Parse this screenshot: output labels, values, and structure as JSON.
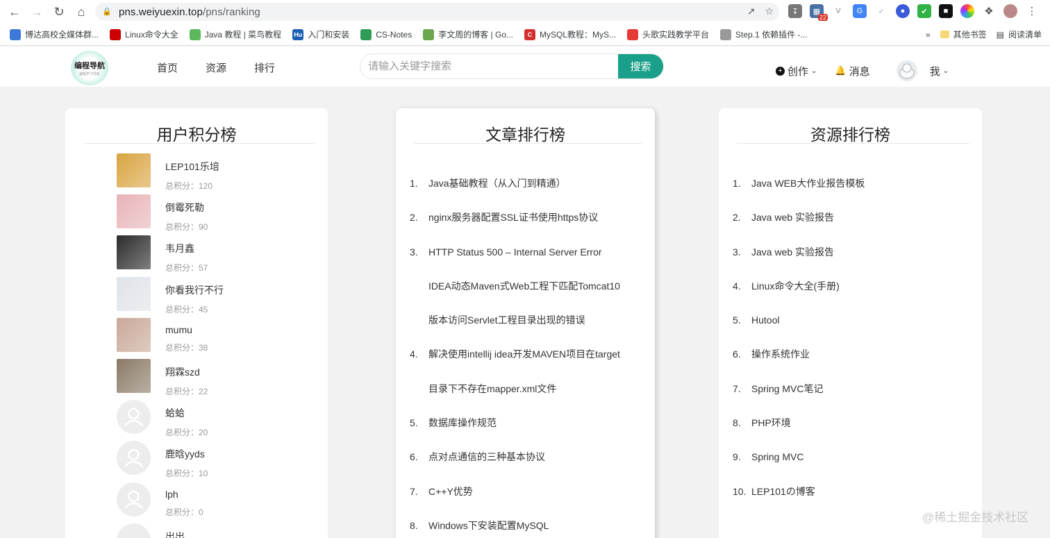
{
  "browser": {
    "url_host": "pns.weiyuexin.top",
    "url_path": "/pns/ranking",
    "extension_badge": "22",
    "bookmarks": [
      {
        "label": "博达高校全媒体群...",
        "color": "#3c78d8",
        "icon": "globe-icon"
      },
      {
        "label": "Linux命令大全",
        "color": "#cc0000",
        "icon": "redhat-icon"
      },
      {
        "label": "Java 教程 | 菜鸟教程",
        "color": "#5cb85c",
        "icon": "runoob-icon"
      },
      {
        "label": "入门和安装",
        "color": "#1a5fb4",
        "icon": "hu-icon",
        "icon_text": "Hu"
      },
      {
        "label": "CS-Notes",
        "color": "#2e9b57",
        "icon": "cs-notes-icon"
      },
      {
        "label": "李文周的博客 | Go...",
        "color": "#6aa84f",
        "icon": "blog-icon"
      },
      {
        "label": "MySQL教程：MyS...",
        "color": "#d32f2f",
        "icon": "c-icon",
        "icon_text": "C"
      },
      {
        "label": "头歌实践教学平台",
        "color": "#e53935",
        "icon": "touge-icon"
      },
      {
        "label": "Step.1 依赖插件 -...",
        "color": "#999999",
        "icon": "step-icon"
      }
    ],
    "bookmark_more": "»",
    "other_bookmarks": "其他书签",
    "reading_list": "阅读清单"
  },
  "header": {
    "logo_text": "编程导航",
    "logo_sub": "编程学习导航",
    "nav": [
      "首页",
      "资源",
      "排行"
    ],
    "search_placeholder": "请输入关键字搜索",
    "search_button": "搜索",
    "create": "创作",
    "messages": "消息",
    "me": "我"
  },
  "users_card": {
    "title": "用户积分榜",
    "score_prefix": "总积分：",
    "users": [
      {
        "name": "LEP101乐培",
        "score": "120",
        "avatar": "#d9a441"
      },
      {
        "name": "倒霉死勒",
        "score": "90",
        "avatar": "#e8b4b8"
      },
      {
        "name": "韦月鑫",
        "score": "57",
        "avatar": "#2b2b2b"
      },
      {
        "name": "你看我行不行",
        "score": "45",
        "avatar": "#dfe3e8"
      },
      {
        "name": "mumu",
        "score": "38",
        "avatar": "#c9a898"
      },
      {
        "name": "翔霖szd",
        "score": "22",
        "avatar": "#8a7a66"
      },
      {
        "name": "蛤蛤",
        "score": "20",
        "avatar": "default"
      },
      {
        "name": "鹿晗yyds",
        "score": "10",
        "avatar": "default"
      },
      {
        "name": "lph",
        "score": "0",
        "avatar": "default"
      }
    ],
    "partial_user_name": "出出"
  },
  "articles_card": {
    "title": "文章排行榜",
    "items": [
      {
        "num": "1.",
        "lines": [
          "Java基础教程（从入门到精通）"
        ]
      },
      {
        "num": "2.",
        "lines": [
          "nginx服务器配置SSL证书使用https协议"
        ]
      },
      {
        "num": "3.",
        "lines": [
          "HTTP Status 500 – Internal Server Error",
          "IDEA动态Maven式Web工程下匹配Tomcat10",
          "版本访问Servlet工程目录出现的错误"
        ]
      },
      {
        "num": "4.",
        "lines": [
          "解决使用intellij idea开发MAVEN项目在target",
          "目录下不存在mapper.xml文件"
        ]
      },
      {
        "num": "5.",
        "lines": [
          "数据库操作规范"
        ]
      },
      {
        "num": "6.",
        "lines": [
          "点对点通信的三种基本协议"
        ]
      },
      {
        "num": "7.",
        "lines": [
          "C++Y优势"
        ]
      },
      {
        "num": "8.",
        "lines": [
          "Windows下安装配置MySQL"
        ]
      }
    ]
  },
  "resources_card": {
    "title": "资源排行榜",
    "items": [
      {
        "num": "1.",
        "text": "Java WEB大作业报告模板"
      },
      {
        "num": "2.",
        "text": "Java web 实验报告"
      },
      {
        "num": "3.",
        "text": "Java web 实验报告"
      },
      {
        "num": "4.",
        "text": "Linux命令大全(手册)"
      },
      {
        "num": "5.",
        "text": "Hutool"
      },
      {
        "num": "6.",
        "text": "操作系统作业"
      },
      {
        "num": "7.",
        "text": "Spring MVC笔记"
      },
      {
        "num": "8.",
        "text": "PHP环境"
      },
      {
        "num": "9.",
        "text": "Spring MVC"
      },
      {
        "num": "10.",
        "text": "LEP101の博客"
      }
    ]
  },
  "watermark": "@稀土掘金技术社区"
}
